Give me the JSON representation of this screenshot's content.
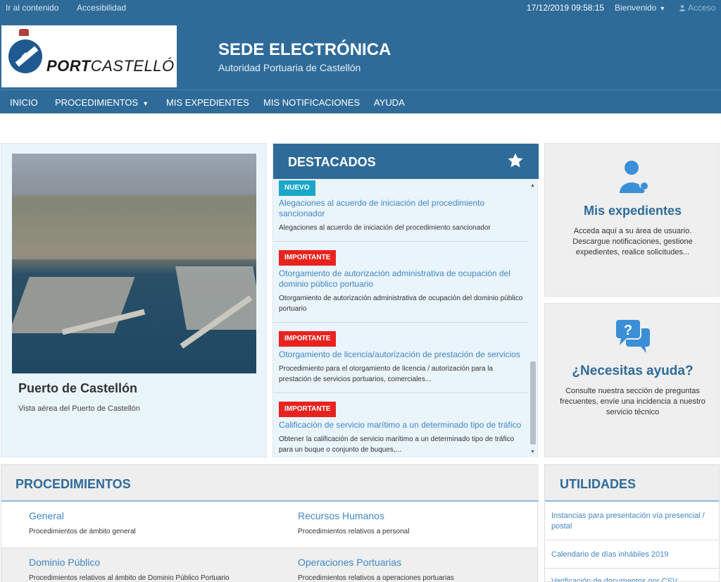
{
  "topbar": {
    "skip_link": "Ir al contenido",
    "accessibility_link": "Accesibilidad",
    "datetime": "17/12/2019 09:58:15",
    "welcome": "Bienvenido",
    "login": "Acceso"
  },
  "header": {
    "logo_bold": "PORT",
    "logo_rest": "CASTELLÓ",
    "title": "SEDE ELECTRÓNICA",
    "subtitle": "Autoridad Portuaria de Castellón"
  },
  "nav": {
    "items": [
      "INICIO",
      "PROCEDIMIENTOS",
      "MIS EXPEDIENTES",
      "MIS NOTIFICACIONES",
      "AYUDA"
    ]
  },
  "port": {
    "title": "Puerto de Castellón",
    "description": "Vista aérea del Puerto de Castellón"
  },
  "destacados": {
    "title": "DESTACADOS",
    "items": [
      {
        "badge": "NUEVO",
        "link": "Alegaciones al acuerdo de iniciación del procedimiento sancionador",
        "text": "Alegaciones al acuerdo de iniciación del procedimiento sancionador"
      },
      {
        "badge": "IMPORTANTE",
        "link": "Otorgamiento de autorización administrativa de ocupación del dominio público portuario",
        "text": "Otorgamiento de autorización administrativa de ocupación del dominio público portuario"
      },
      {
        "badge": "IMPORTANTE",
        "link": "Otorgamiento de licencia/autorización de prestación de servicios",
        "text": "Procedimiento para el otorgamiento de licencia / autorización para la prestación de servicios portuarios, comerciales..."
      },
      {
        "badge": "IMPORTANTE",
        "link": "Calificación de servicio marítimo a un determinado tipo de tráfico",
        "text": "Obtener la calificación de servicio marítimo a un determinado tipo de tráfico para un buque o conjunto de buques,..."
      }
    ]
  },
  "expedientes": {
    "title": "Mis expedientes",
    "text": "Acceda aquí a su área de usuario. Descargue notificaciones, gestione expedientes, realice solicitudes..."
  },
  "ayuda": {
    "title": "¿Necesitas ayuda?",
    "text": "Consulte nuestra sección de preguntas frecuentes, envíe una incidencia a nuestro servicio técnico"
  },
  "procedimientos": {
    "title": "PROCEDIMIENTOS",
    "items": [
      {
        "name": "General",
        "desc": "Procedimientos de ámbito general"
      },
      {
        "name": "Recursos Humanos",
        "desc": "Procedimientos relativos a personal"
      },
      {
        "name": "Dominio Público",
        "desc": "Procedimientos relativos al ámbito de Dominio Público Portuario"
      },
      {
        "name": "Operaciones Portuarias",
        "desc": "Procedimientos relativos a operaciones portuarias"
      }
    ]
  },
  "utilidades": {
    "title": "UTILIDADES",
    "items": [
      "Instancias para presentación vía presencial / postal",
      "Calendario de días inhábiles 2019",
      "Verificación de documentos por CSV"
    ]
  },
  "colors": {
    "brand_blue": "#2f6b99",
    "link_blue": "#3f87c6",
    "badge_new": "#1aa7c9",
    "badge_important": "#e8231f"
  },
  "icons": [
    "user-icon",
    "caret-down-icon",
    "star-icon",
    "user-key-icon",
    "help-chat-icon",
    "scroll-up-icon",
    "scroll-down-icon"
  ]
}
